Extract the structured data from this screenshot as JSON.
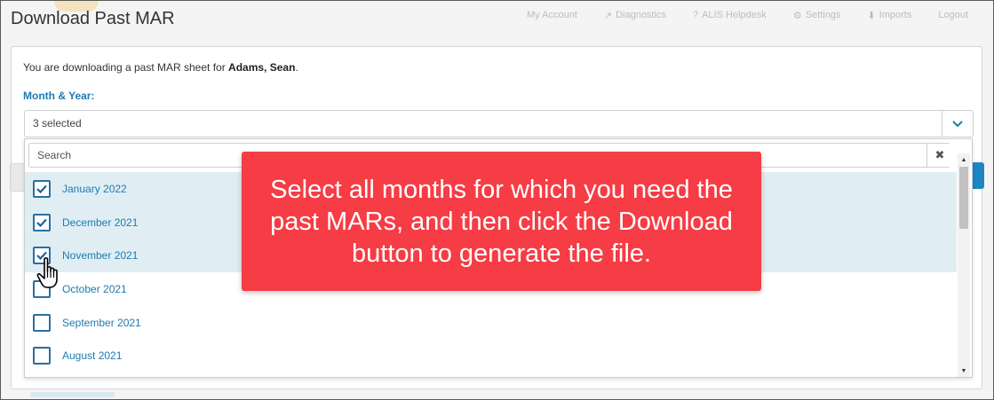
{
  "background_app": {
    "nav": [
      "My Account",
      "Diagnostics",
      "ALIS Helpdesk",
      "Settings",
      "Imports",
      "Logout"
    ]
  },
  "modal": {
    "title": "Download Past MAR",
    "intro_prefix": "You are downloading a past MAR sheet for ",
    "resident_name": "Adams, Sean",
    "intro_suffix": ".",
    "field_label": "Month & Year:",
    "select_value": "3 selected",
    "search_placeholder": "Search",
    "months": [
      {
        "label": "January 2022",
        "checked": true
      },
      {
        "label": "December 2021",
        "checked": true
      },
      {
        "label": "November 2021",
        "checked": true
      },
      {
        "label": "October 2021",
        "checked": false
      },
      {
        "label": "September 2021",
        "checked": false
      },
      {
        "label": "August 2021",
        "checked": false
      }
    ]
  },
  "callout": {
    "text": "Select all months for which you need the past MARs, and then click the Download button to generate the file."
  },
  "colors": {
    "accent": "#1d7bb0",
    "callout": "#f63c45",
    "selected_row": "#e0eef4",
    "checkbox_border": "#2a6fa0"
  },
  "icons": {
    "select_toggle": "chevron-down-icon",
    "search_clear": "close-icon",
    "checkbox": "checkmark-icon",
    "cursor": "hand-pointer-icon"
  }
}
